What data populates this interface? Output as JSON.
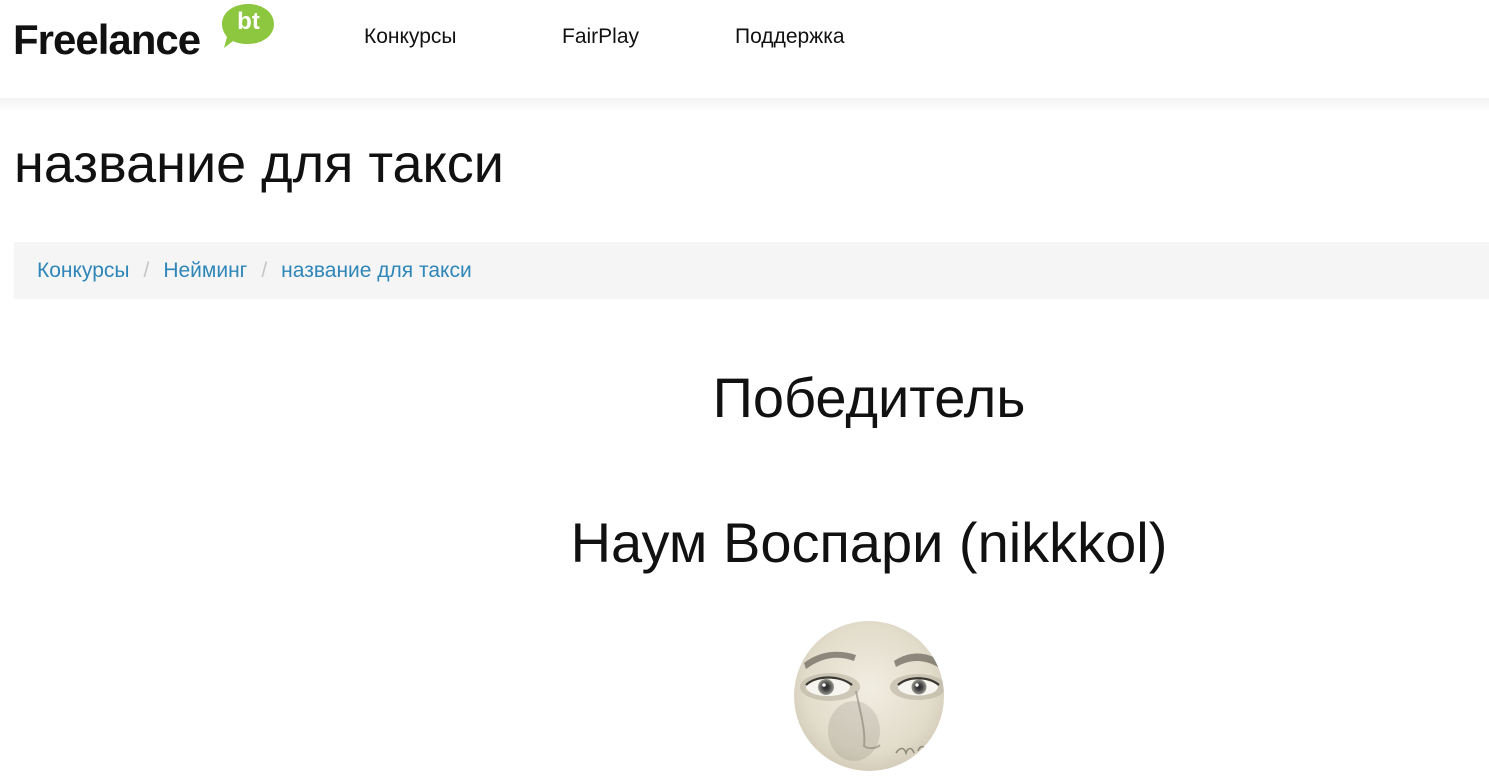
{
  "header": {
    "logo": {
      "word": "Freelance",
      "badge": "bt",
      "badge_color": "#8dc63f"
    },
    "nav": [
      {
        "label": "Конкурсы"
      },
      {
        "label": "FairPlay"
      },
      {
        "label": "Поддержка"
      }
    ]
  },
  "page": {
    "title": "название для такси"
  },
  "breadcrumb": {
    "items": [
      {
        "label": "Конкурсы"
      },
      {
        "label": "Нейминг"
      },
      {
        "label": "название для такси"
      }
    ],
    "separator": "/",
    "link_color": "#2f86b8"
  },
  "winner": {
    "heading": "Победитель",
    "name": "Наум Воспари (nikkkol)",
    "avatar_icon": "user-avatar-photo"
  }
}
